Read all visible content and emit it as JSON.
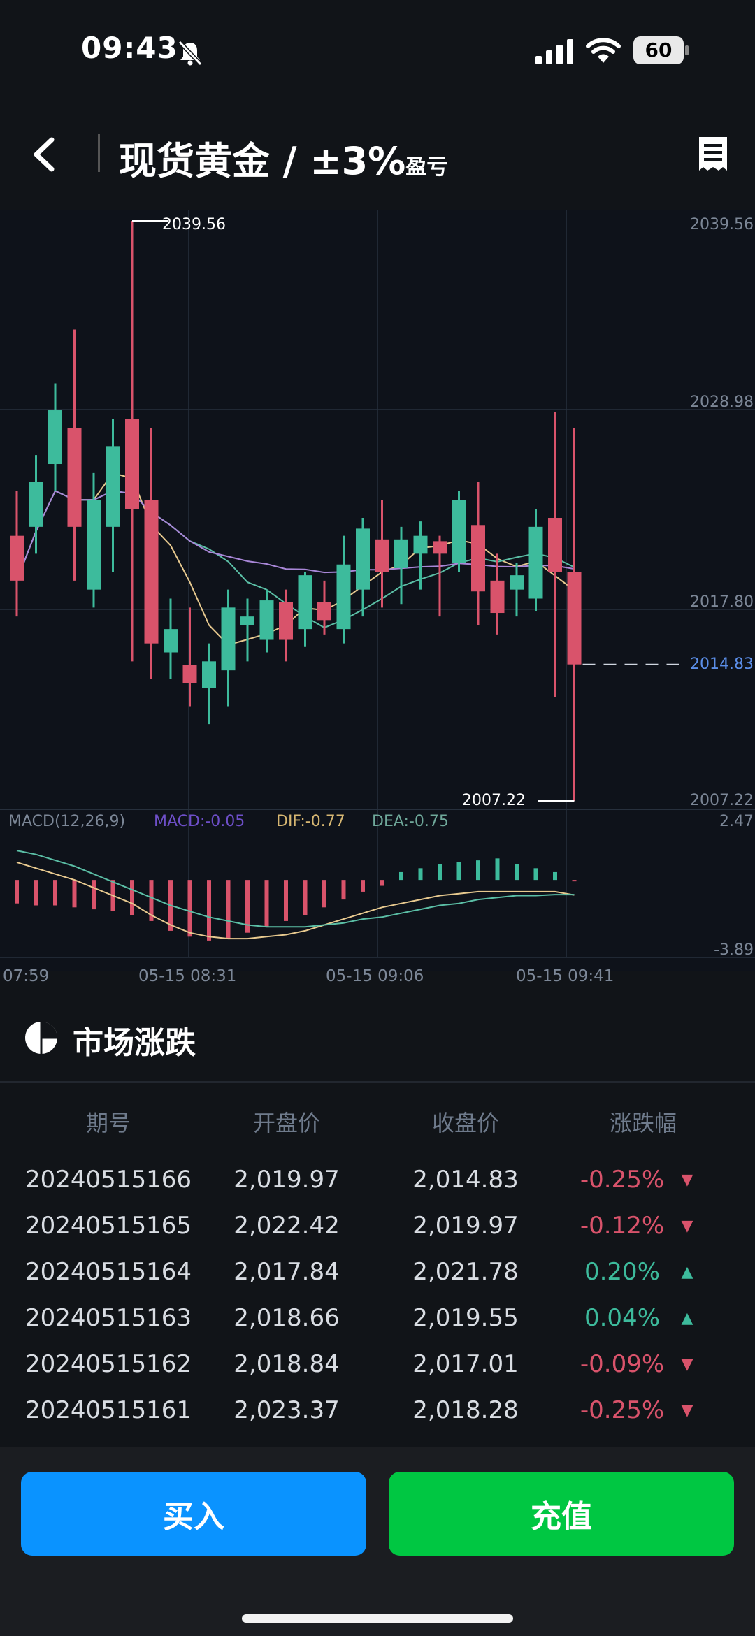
{
  "status_bar": {
    "time": "09:43",
    "battery": "60",
    "icons": [
      "bell-slash-icon",
      "signal-icon",
      "wifi-icon",
      "battery-icon"
    ]
  },
  "nav": {
    "title": "现货黄金 / ±3%",
    "title_suffix": "盈亏",
    "back_icon": "chevron-left-icon",
    "record_icon": "receipt-list-icon"
  },
  "colors": {
    "up": "#3dbb9c",
    "down": "#d9536b",
    "ma1": "#e7c98f",
    "ma2": "#5bbfa6",
    "ma3": "#a987d8",
    "blue_label": "#5b8ee8"
  },
  "chart_data": {
    "type": "candlestick",
    "y_axis": [
      "2039.56",
      "2028.98",
      "2017.80",
      "2007.22"
    ],
    "ylim": [
      2007.22,
      2039.56
    ],
    "high_label": "2039.56",
    "low_label": "2007.22",
    "current_price": "2014.83",
    "x_ticks": [
      "07:59",
      "05-15 08:31",
      "05-15 09:06",
      "05-15 09:41"
    ],
    "candles": [
      {
        "o": 2022.0,
        "c": 2019.5,
        "h": 2024.5,
        "l": 2017.5
      },
      {
        "o": 2022.5,
        "c": 2025.0,
        "h": 2026.5,
        "l": 2021.0
      },
      {
        "o": 2026.0,
        "c": 2029.0,
        "h": 2030.5,
        "l": 2024.5
      },
      {
        "o": 2028.0,
        "c": 2022.5,
        "h": 2033.5,
        "l": 2019.5
      },
      {
        "o": 2019.0,
        "c": 2024.0,
        "h": 2025.5,
        "l": 2018.0
      },
      {
        "o": 2022.5,
        "c": 2027.0,
        "h": 2028.5,
        "l": 2020.0
      },
      {
        "o": 2028.5,
        "c": 2023.5,
        "h": 2039.56,
        "l": 2015.0
      },
      {
        "o": 2024.0,
        "c": 2016.0,
        "h": 2028.0,
        "l": 2014.0
      },
      {
        "o": 2015.5,
        "c": 2016.8,
        "h": 2018.5,
        "l": 2014.0
      },
      {
        "o": 2014.8,
        "c": 2013.8,
        "h": 2018.0,
        "l": 2012.5
      },
      {
        "o": 2013.5,
        "c": 2015.0,
        "h": 2016.0,
        "l": 2011.5
      },
      {
        "o": 2014.5,
        "c": 2018.0,
        "h": 2019.0,
        "l": 2012.5
      },
      {
        "o": 2017.0,
        "c": 2017.5,
        "h": 2018.5,
        "l": 2015.0
      },
      {
        "o": 2016.2,
        "c": 2018.4,
        "h": 2019.0,
        "l": 2015.5
      },
      {
        "o": 2018.3,
        "c": 2016.2,
        "h": 2019.0,
        "l": 2015.0
      },
      {
        "o": 2016.8,
        "c": 2019.8,
        "h": 2020.0,
        "l": 2015.8
      },
      {
        "o": 2018.3,
        "c": 2017.3,
        "h": 2019.5,
        "l": 2016.5
      },
      {
        "o": 2016.8,
        "c": 2020.4,
        "h": 2022.0,
        "l": 2016.0
      },
      {
        "o": 2019.0,
        "c": 2022.4,
        "h": 2023.0,
        "l": 2017.5
      },
      {
        "o": 2021.8,
        "c": 2020.0,
        "h": 2024.0,
        "l": 2018.0
      },
      {
        "o": 2020.2,
        "c": 2021.8,
        "h": 2022.5,
        "l": 2018.2
      },
      {
        "o": 2021.0,
        "c": 2022.0,
        "h": 2022.8,
        "l": 2019.0
      },
      {
        "o": 2021.7,
        "c": 2021.0,
        "h": 2022.0,
        "l": 2017.5
      },
      {
        "o": 2020.5,
        "c": 2024.0,
        "h": 2024.5,
        "l": 2020.0
      },
      {
        "o": 2022.6,
        "c": 2018.9,
        "h": 2025.0,
        "l": 2017.0
      },
      {
        "o": 2019.5,
        "c": 2017.7,
        "h": 2021.0,
        "l": 2016.5
      },
      {
        "o": 2019.0,
        "c": 2019.8,
        "h": 2020.5,
        "l": 2017.5
      },
      {
        "o": 2018.5,
        "c": 2022.5,
        "h": 2023.5,
        "l": 2017.8
      },
      {
        "o": 2023.0,
        "c": 2019.97,
        "h": 2028.9,
        "l": 2013.0
      },
      {
        "o": 2019.97,
        "c": 2014.83,
        "h": 2028.0,
        "l": 2007.22
      }
    ],
    "macd_label": "MACD(12,26,9)",
    "macd_value": "MACD:-0.05",
    "dif_value": "DIF:-0.77",
    "dea_value": "DEA:-0.75",
    "macd_ylim": [
      "2.47",
      "-3.89"
    ],
    "macd_bars": [
      -1.2,
      -1.3,
      -1.3,
      -1.4,
      -1.5,
      -1.6,
      -1.8,
      -2.1,
      -2.6,
      -2.9,
      -3.1,
      -3.0,
      -2.7,
      -2.4,
      -2.1,
      -1.8,
      -1.4,
      -1.0,
      -0.6,
      -0.3,
      0.4,
      0.6,
      0.8,
      0.9,
      1.0,
      1.1,
      0.8,
      0.6,
      0.4,
      -0.05
    ],
    "dif_line": [
      0.9,
      0.6,
      0.3,
      0.0,
      -0.4,
      -0.8,
      -1.2,
      -1.8,
      -2.3,
      -2.7,
      -2.9,
      -3.0,
      -3.0,
      -2.9,
      -2.8,
      -2.6,
      -2.3,
      -2.0,
      -1.7,
      -1.4,
      -1.2,
      -1.0,
      -0.8,
      -0.7,
      -0.6,
      -0.6,
      -0.6,
      -0.6,
      -0.6,
      -0.77
    ],
    "dea_line": [
      1.5,
      1.3,
      1.0,
      0.7,
      0.3,
      -0.1,
      -0.5,
      -0.9,
      -1.3,
      -1.6,
      -1.9,
      -2.1,
      -2.3,
      -2.4,
      -2.4,
      -2.4,
      -2.3,
      -2.2,
      -2.0,
      -1.9,
      -1.7,
      -1.5,
      -1.3,
      -1.2,
      -1.0,
      -0.9,
      -0.8,
      -0.8,
      -0.75,
      -0.75
    ]
  },
  "market": {
    "title": "市场涨跌",
    "headers": [
      "期号",
      "开盘价",
      "收盘价",
      "涨跌幅"
    ],
    "rows": [
      {
        "period": "20240515166",
        "open": "2,019.97",
        "close": "2,014.83",
        "change": "-0.25%",
        "dir": "down"
      },
      {
        "period": "20240515165",
        "open": "2,022.42",
        "close": "2,019.97",
        "change": "-0.12%",
        "dir": "down"
      },
      {
        "period": "20240515164",
        "open": "2,017.84",
        "close": "2,021.78",
        "change": "0.20%",
        "dir": "up"
      },
      {
        "period": "20240515163",
        "open": "2,018.66",
        "close": "2,019.55",
        "change": "0.04%",
        "dir": "up"
      },
      {
        "period": "20240515162",
        "open": "2,018.84",
        "close": "2,017.01",
        "change": "-0.09%",
        "dir": "down"
      },
      {
        "period": "20240515161",
        "open": "2,023.37",
        "close": "2,018.28",
        "change": "-0.25%",
        "dir": "down"
      }
    ]
  },
  "actions": {
    "buy": "买入",
    "recharge": "充值"
  }
}
